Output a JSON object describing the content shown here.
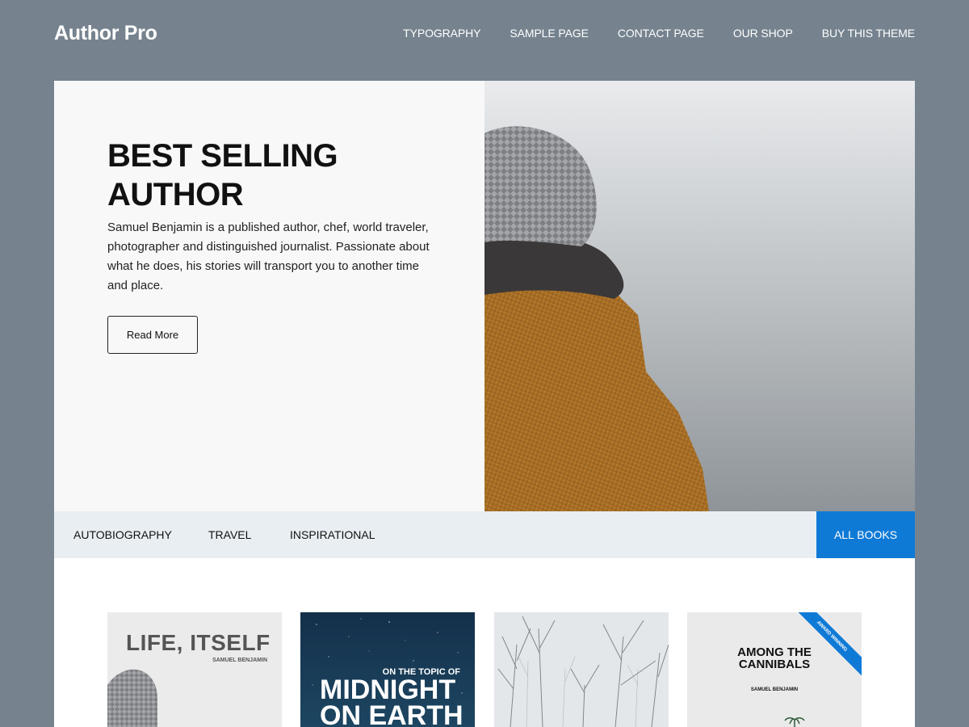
{
  "header": {
    "site_title": "Author Pro",
    "nav": [
      "TYPOGRAPHY",
      "SAMPLE PAGE",
      "CONTACT PAGE",
      "OUR SHOP",
      "BUY THIS THEME"
    ]
  },
  "hero": {
    "title_line1": "BEST SELLING",
    "title_line2": "AUTHOR",
    "description": "Samuel Benjamin is a published author, chef, world traveler, photographer and distinguished journalist. Passionate about what he does, his stories will transport you to another time and place.",
    "button_label": "Read More"
  },
  "tabs": {
    "items": [
      "AUTOBIOGRAPHY",
      "TRAVEL",
      "INSPIRATIONAL"
    ],
    "all_label": "ALL BOOKS"
  },
  "books": [
    {
      "title": "LIFE, ITSELF",
      "author": "SAMUEL BENJAMIN"
    },
    {
      "subtitle": "ON THE TOPIC OF",
      "title_line1": "MIDNIGHT",
      "title_line2": "ON EARTH"
    },
    {
      "title": ""
    },
    {
      "title_line1": "AMONG THE",
      "title_line2": "CANNIBALS",
      "author": "SAMUEL BENJAMIN",
      "ribbon": "AWARD WINNING"
    }
  ],
  "colors": {
    "page_background": "#76838f",
    "accent": "#0f7ad6",
    "tab_bar": "#e8eef2"
  }
}
